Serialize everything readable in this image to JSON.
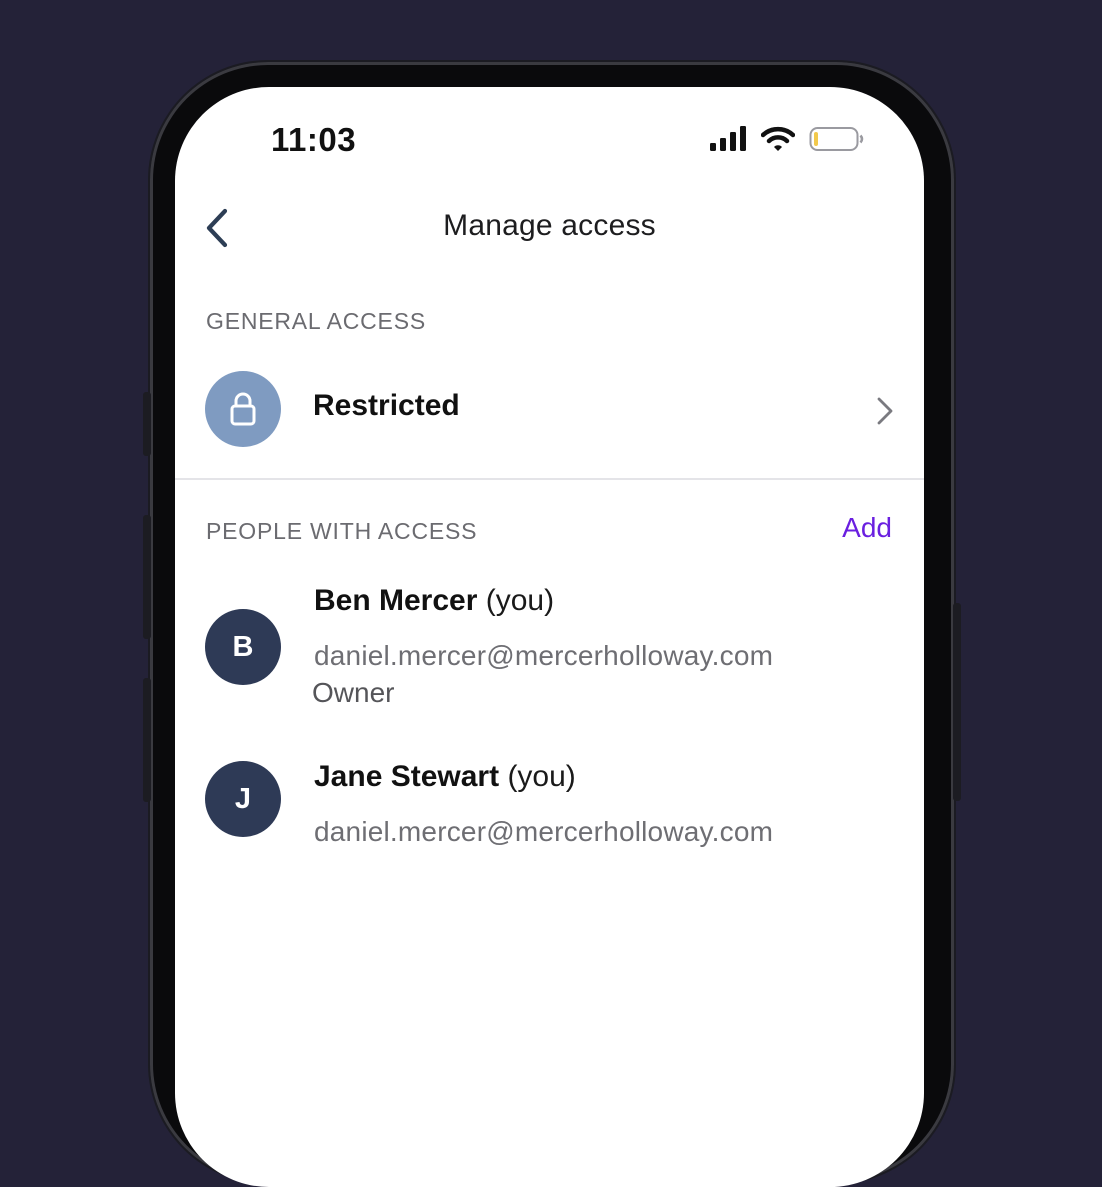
{
  "status_bar": {
    "time": "11:03",
    "icons": [
      "signal-icon",
      "wifi-icon",
      "battery-icon"
    ],
    "battery_level": 0.1
  },
  "nav": {
    "title": "Manage access",
    "back_icon": "chevron-left-icon"
  },
  "general_access": {
    "section_label": "GENERAL ACCESS",
    "icon": "lock-icon",
    "value": "Restricted",
    "chevron_icon": "chevron-right-icon"
  },
  "people": {
    "section_label": "PEOPLE WITH ACCESS",
    "add_label": "Add",
    "members": [
      {
        "initial": "B",
        "name": "Ben Mercer",
        "you_tag": "(you)",
        "email": "daniel.mercer@mercerholloway.com",
        "role": "Owner"
      },
      {
        "initial": "J",
        "name": "Jane Stewart",
        "you_tag": "(you)",
        "email": "daniel.mercer@mercerholloway.com"
      }
    ]
  },
  "colors": {
    "background": "#242238",
    "accent": "#6a1fe0",
    "lock_avatar": "#7f9bc1",
    "person_avatar": "#2e3a56",
    "battery_low": "#f2c94c"
  }
}
